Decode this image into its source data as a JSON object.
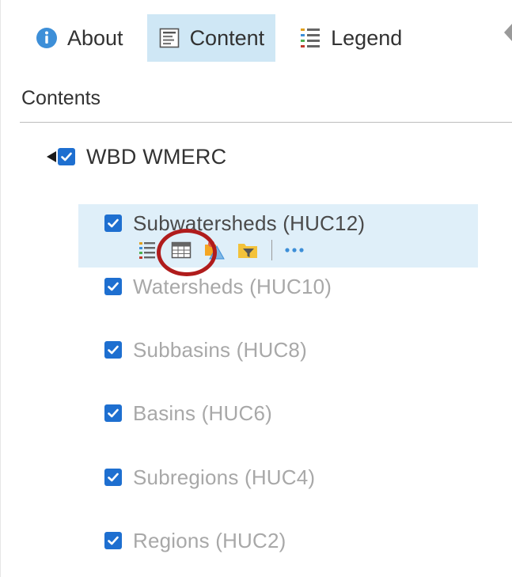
{
  "tabs": [
    {
      "label": "About",
      "icon": "info-icon"
    },
    {
      "label": "Content",
      "icon": "content-icon",
      "active": true
    },
    {
      "label": "Legend",
      "icon": "legend-icon"
    }
  ],
  "contents": {
    "title": "Contents",
    "group": {
      "label": "WBD WMERC",
      "checked": true,
      "expanded": true,
      "layers": [
        {
          "label": "Subwatersheds (HUC12)",
          "checked": true,
          "selected": true
        },
        {
          "label": "Watersheds (HUC10)",
          "checked": true
        },
        {
          "label": "Subbasins (HUC8)",
          "checked": true
        },
        {
          "label": "Basins (HUC6)",
          "checked": true
        },
        {
          "label": "Subregions (HUC4)",
          "checked": true
        },
        {
          "label": "Regions (HUC2)",
          "checked": true
        }
      ]
    },
    "layer_tools": [
      "legend-list-icon",
      "attribute-table-icon",
      "change-style-icon",
      "filter-icon",
      "more-options-icon"
    ]
  },
  "colors": {
    "checkbox": "#1e6fd0",
    "active_tab_bg": "#cfe7f5",
    "selected_row_bg": "#dfeff9",
    "annotation": "#b01c1c"
  }
}
